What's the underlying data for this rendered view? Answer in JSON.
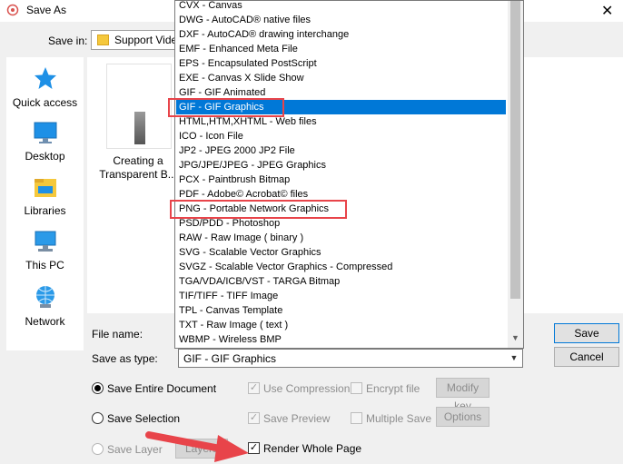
{
  "window": {
    "title": "Save As"
  },
  "save_in": {
    "label": "Save in:",
    "value": "Support Videos"
  },
  "places": [
    {
      "label": "Quick access",
      "icon": "star-icon"
    },
    {
      "label": "Desktop",
      "icon": "desktop-icon"
    },
    {
      "label": "Libraries",
      "icon": "libraries-icon"
    },
    {
      "label": "This PC",
      "icon": "computer-icon"
    },
    {
      "label": "Network",
      "icon": "network-icon"
    }
  ],
  "files": [
    {
      "name_line1": "Creating a",
      "name_line2": "Transparent B..."
    }
  ],
  "file_name": {
    "label": "File name:",
    "value": ""
  },
  "save_as_type": {
    "label": "Save as type:",
    "value": "GIF - GIF Graphics",
    "options": [
      "CVX - Canvas",
      "DWG - AutoCAD® native files",
      "DXF - AutoCAD® drawing interchange",
      "EMF - Enhanced Meta File",
      "EPS - Encapsulated PostScript",
      "EXE - Canvas X Slide Show",
      "GIF - GIF Animated",
      "GIF - GIF Graphics",
      "HTML,HTM,XHTML - Web files",
      "ICO - Icon File",
      "JP2 - JPEG 2000 JP2 File",
      "JPG/JPE/JPEG - JPEG Graphics",
      "PCX - Paintbrush Bitmap",
      "PDF - Adobe© Acrobat© files",
      "PNG - Portable Network Graphics",
      "PSD/PDD - Photoshop",
      "RAW - Raw Image ( binary )",
      "SVG - Scalable Vector Graphics",
      "SVGZ - Scalable Vector Graphics - Compressed",
      "TGA/VDA/ICB/VST - TARGA Bitmap",
      "TIF/TIFF - TIFF Image",
      "TPL - Canvas Template",
      "TXT - Raw Image ( text )",
      "WBMP - Wireless BMP"
    ],
    "selected_option": "GIF - GIF Graphics",
    "highlighted_options": [
      "GIF - GIF Graphics",
      "PNG - Portable Network Graphics"
    ]
  },
  "buttons": {
    "save": "Save",
    "cancel": "Cancel",
    "modify_key": "Modify key",
    "options": "Options",
    "layers": "Layers"
  },
  "radios": [
    {
      "label": "Save Entire Document",
      "checked": true,
      "enabled": true
    },
    {
      "label": "Save Selection",
      "checked": false,
      "enabled": true
    },
    {
      "label": "Save Layer",
      "checked": false,
      "enabled": false
    }
  ],
  "checkboxes": {
    "use_compression": {
      "label": "Use Compression",
      "checked": true,
      "enabled": false
    },
    "encrypt_file": {
      "label": "Encrypt file",
      "checked": false,
      "enabled": false
    },
    "save_preview": {
      "label": "Save Preview",
      "checked": true,
      "enabled": false
    },
    "multiple_save": {
      "label": "Multiple Save",
      "checked": false,
      "enabled": false
    },
    "render_whole_page": {
      "label": "Render Whole Page",
      "checked": true,
      "enabled": true
    }
  },
  "colors": {
    "selection": "#0078d7",
    "highlight_box": "#e8444a",
    "arrow": "#e8444a"
  }
}
